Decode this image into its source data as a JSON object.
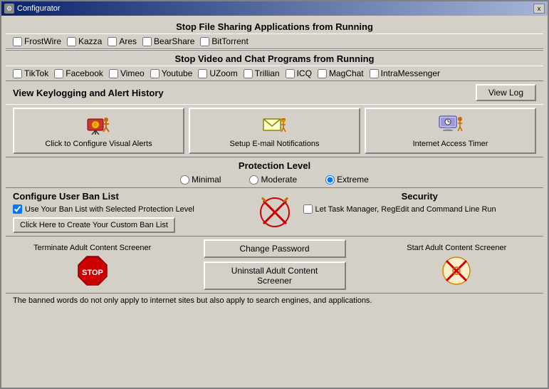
{
  "window": {
    "title": "Configurator",
    "close_label": "x"
  },
  "file_sharing": {
    "header": "Stop File Sharing Applications from Running",
    "apps": [
      {
        "id": "frostwire",
        "label": "FrostWire",
        "checked": false
      },
      {
        "id": "kazza",
        "label": "Kazza",
        "checked": false
      },
      {
        "id": "ares",
        "label": "Ares",
        "checked": false
      },
      {
        "id": "bearshare",
        "label": "BearShare",
        "checked": false
      },
      {
        "id": "bittorrent",
        "label": "BitTorrent",
        "checked": false
      }
    ]
  },
  "video_chat": {
    "header": "Stop Video and Chat Programs from Running",
    "apps": [
      {
        "id": "tiktok",
        "label": "TikTok",
        "checked": false
      },
      {
        "id": "facebook",
        "label": "Facebook",
        "checked": false
      },
      {
        "id": "vimeo",
        "label": "Vimeo",
        "checked": false
      },
      {
        "id": "youtube",
        "label": "Youtube",
        "checked": false
      },
      {
        "id": "uzoom",
        "label": "UZoom",
        "checked": false
      },
      {
        "id": "trillian",
        "label": "Trillian",
        "checked": false
      },
      {
        "id": "icq",
        "label": "ICQ",
        "checked": false
      },
      {
        "id": "magchat",
        "label": "MagChat",
        "checked": false
      },
      {
        "id": "intramessenger",
        "label": "IntraMessenger",
        "checked": false
      }
    ]
  },
  "keylogging": {
    "header": "View Keylogging and Alert History",
    "view_log_label": "View Log"
  },
  "icon_buttons": {
    "configure_visual": "Click to Configure Visual Alerts",
    "setup_email": "Setup E-mail Notifications",
    "internet_access": "Internet Access Timer"
  },
  "protection": {
    "header": "Protection Level",
    "levels": [
      {
        "id": "minimal",
        "label": "Minimal",
        "checked": false
      },
      {
        "id": "moderate",
        "label": "Moderate",
        "checked": false
      },
      {
        "id": "extreme",
        "label": "Extreme",
        "checked": true
      }
    ]
  },
  "ban_list": {
    "header": "Configure User Ban List",
    "use_ban_label": "Use Your Ban List with Selected Protection Level",
    "use_ban_checked": true,
    "create_btn_label": "Click Here to Create Your Custom Ban List"
  },
  "security": {
    "header": "Security",
    "task_manager_label": "Let  Task Manager, RegEdit and Command Line Run",
    "task_manager_checked": false
  },
  "adult_content": {
    "terminate_label": "Terminate Adult Content Screener",
    "start_label": "Start Adult Content Screener",
    "change_password_label": "Change Password",
    "uninstall_label": "Uninstall Adult Content Screener"
  },
  "footer": {
    "note": "The banned words do not only apply to internet sites but also apply to search engines, and applications."
  }
}
